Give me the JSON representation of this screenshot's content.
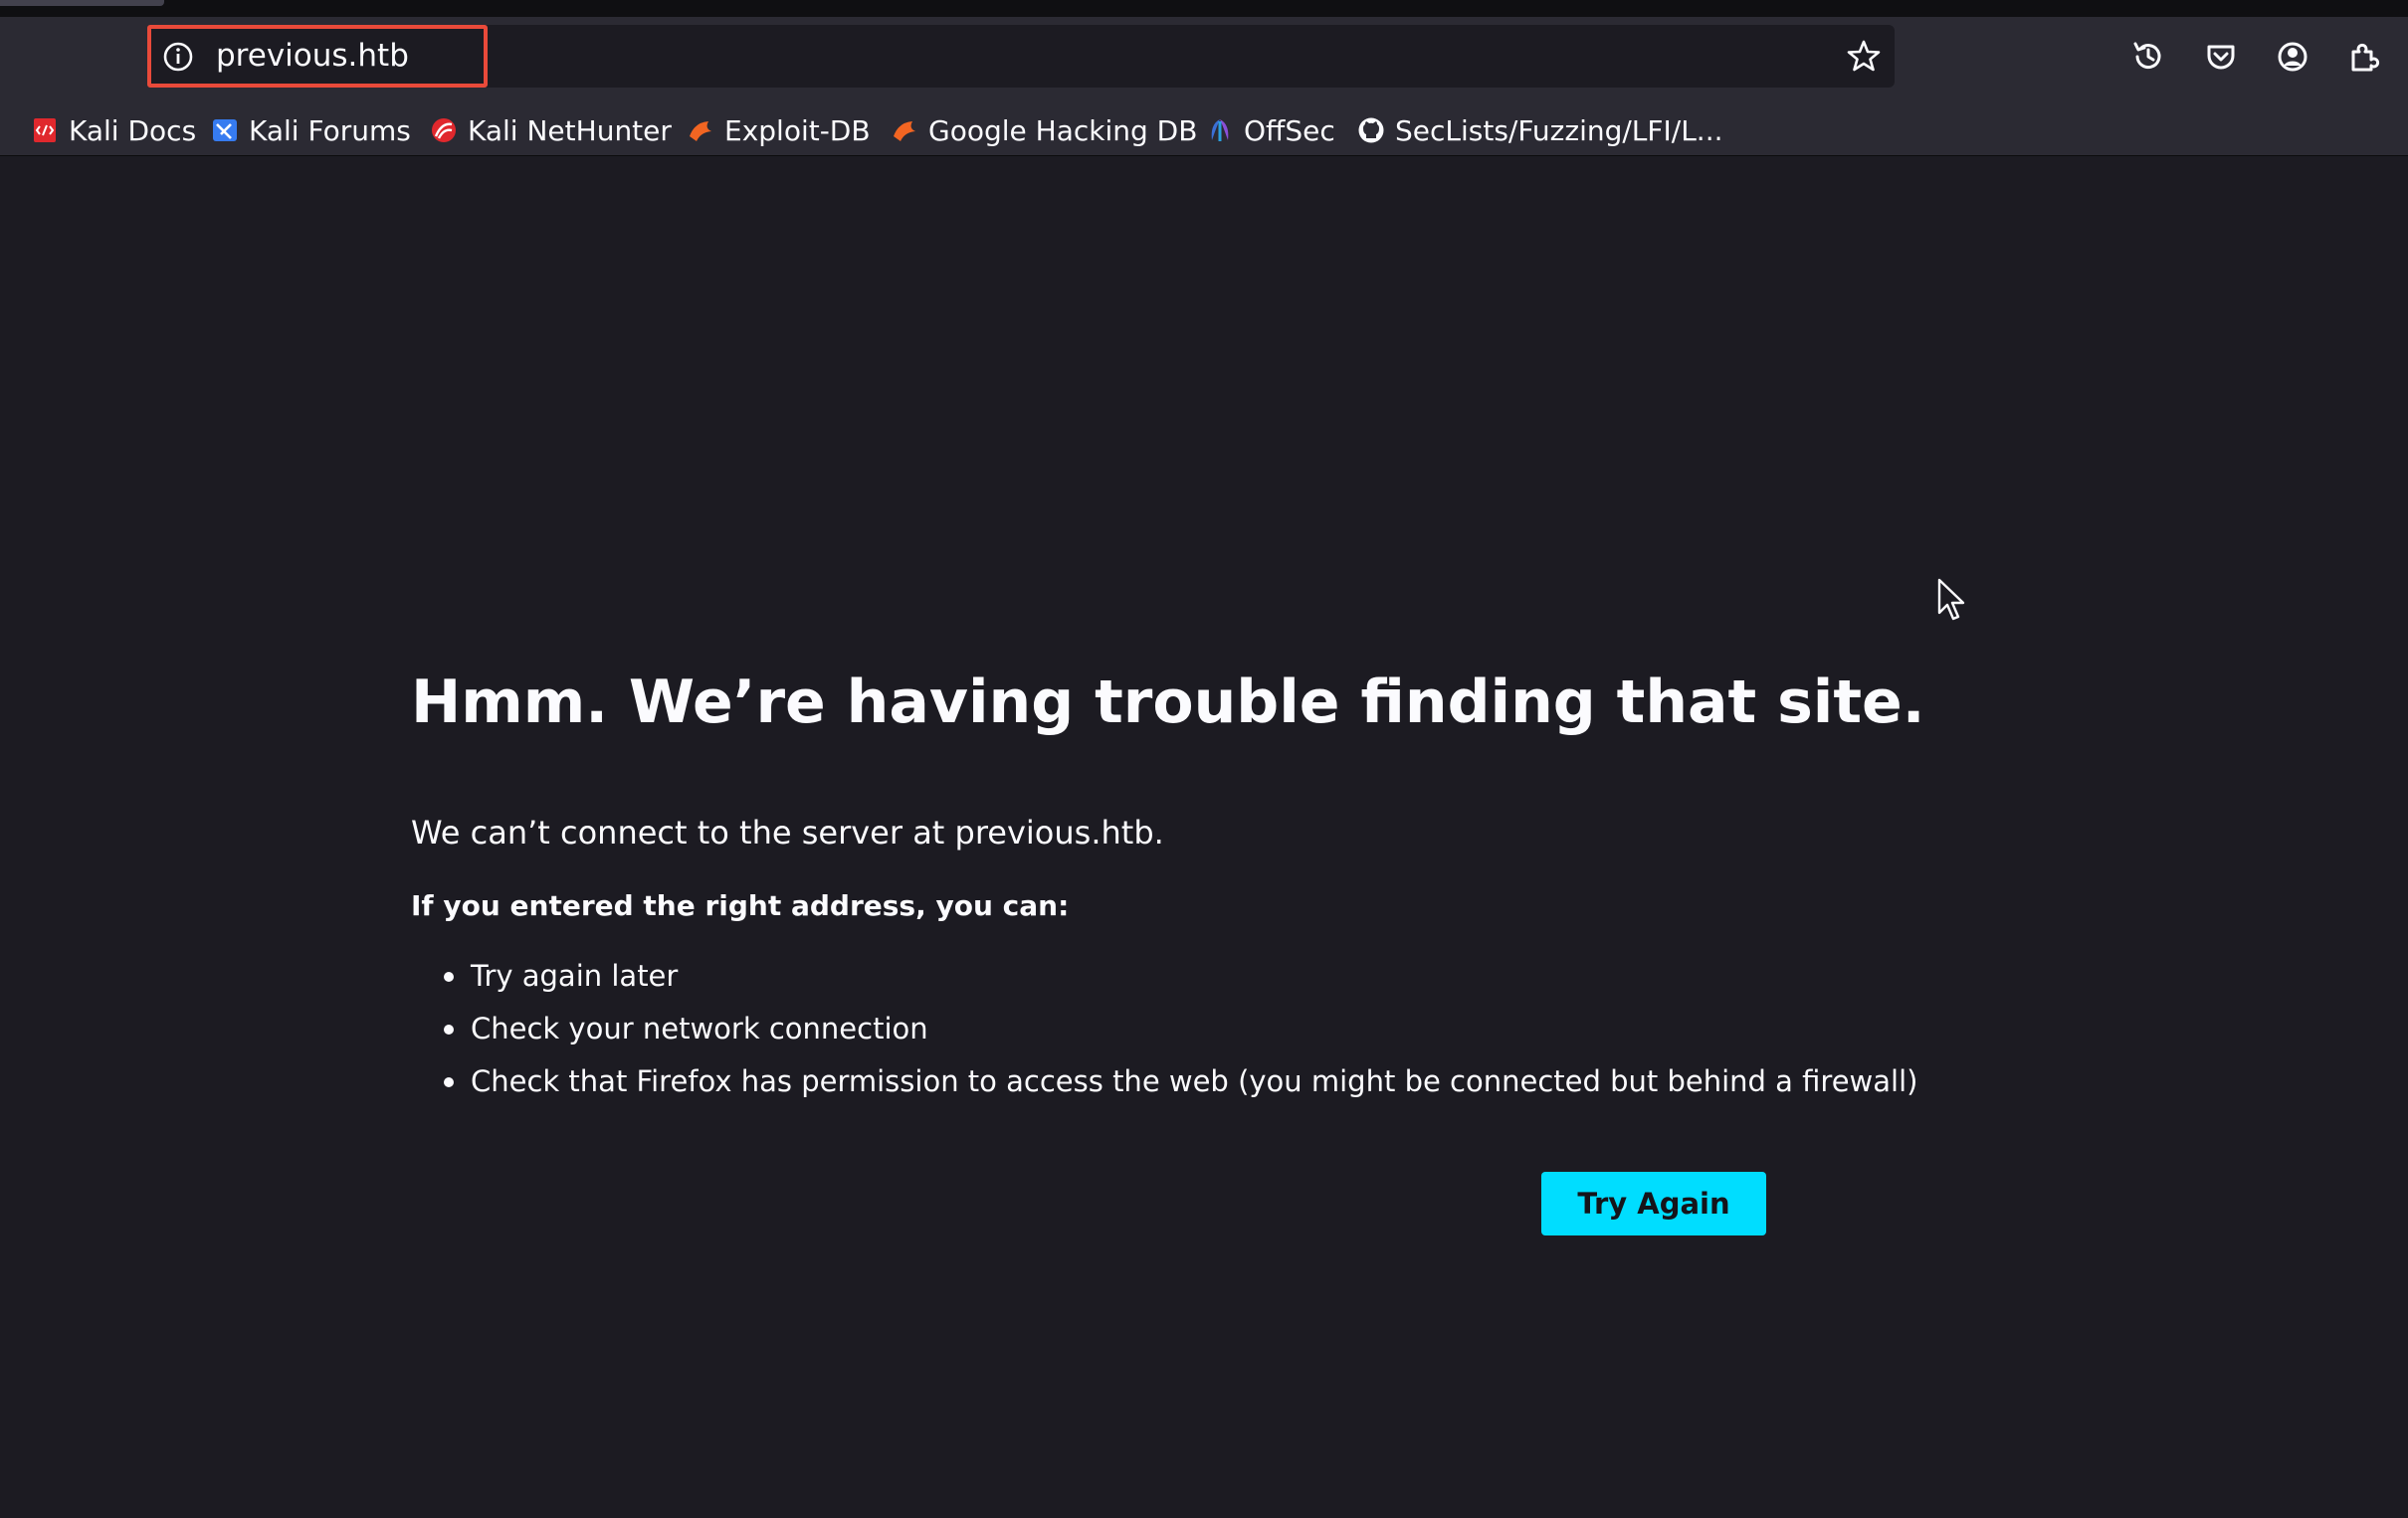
{
  "browser": {
    "url": "previous.htb",
    "colors": {
      "toolbar": "#2b2a33",
      "content_bg": "#1c1b22",
      "url_highlight": "#e94a3a",
      "accent_button": "#00ddff"
    },
    "toolbar_icons": [
      "info-icon",
      "star-icon",
      "history-icon",
      "pocket-icon",
      "account-icon",
      "extensions-icon"
    ]
  },
  "bookmarks": [
    {
      "label": "Kali Docs",
      "icon": "kali-docs-icon"
    },
    {
      "label": "Kali Forums",
      "icon": "kali-forums-icon"
    },
    {
      "label": "Kali NetHunter",
      "icon": "kali-nethunter-icon"
    },
    {
      "label": "Exploit-DB",
      "icon": "exploit-db-icon"
    },
    {
      "label": "Google Hacking DB",
      "icon": "ghdb-icon"
    },
    {
      "label": "OffSec",
      "icon": "offsec-icon"
    },
    {
      "label": "SecLists/Fuzzing/LFI/L...",
      "icon": "github-icon"
    }
  ],
  "error": {
    "title": "Hmm. We’re having trouble finding that site.",
    "description": "We can’t connect to the server at previous.htb.",
    "suggestions_heading": "If you entered the right address, you can:",
    "suggestions": [
      "Try again later",
      "Check your network connection",
      "Check that Firefox has permission to access the web (you might be connected but behind a firewall)"
    ],
    "button_label": "Try Again"
  }
}
